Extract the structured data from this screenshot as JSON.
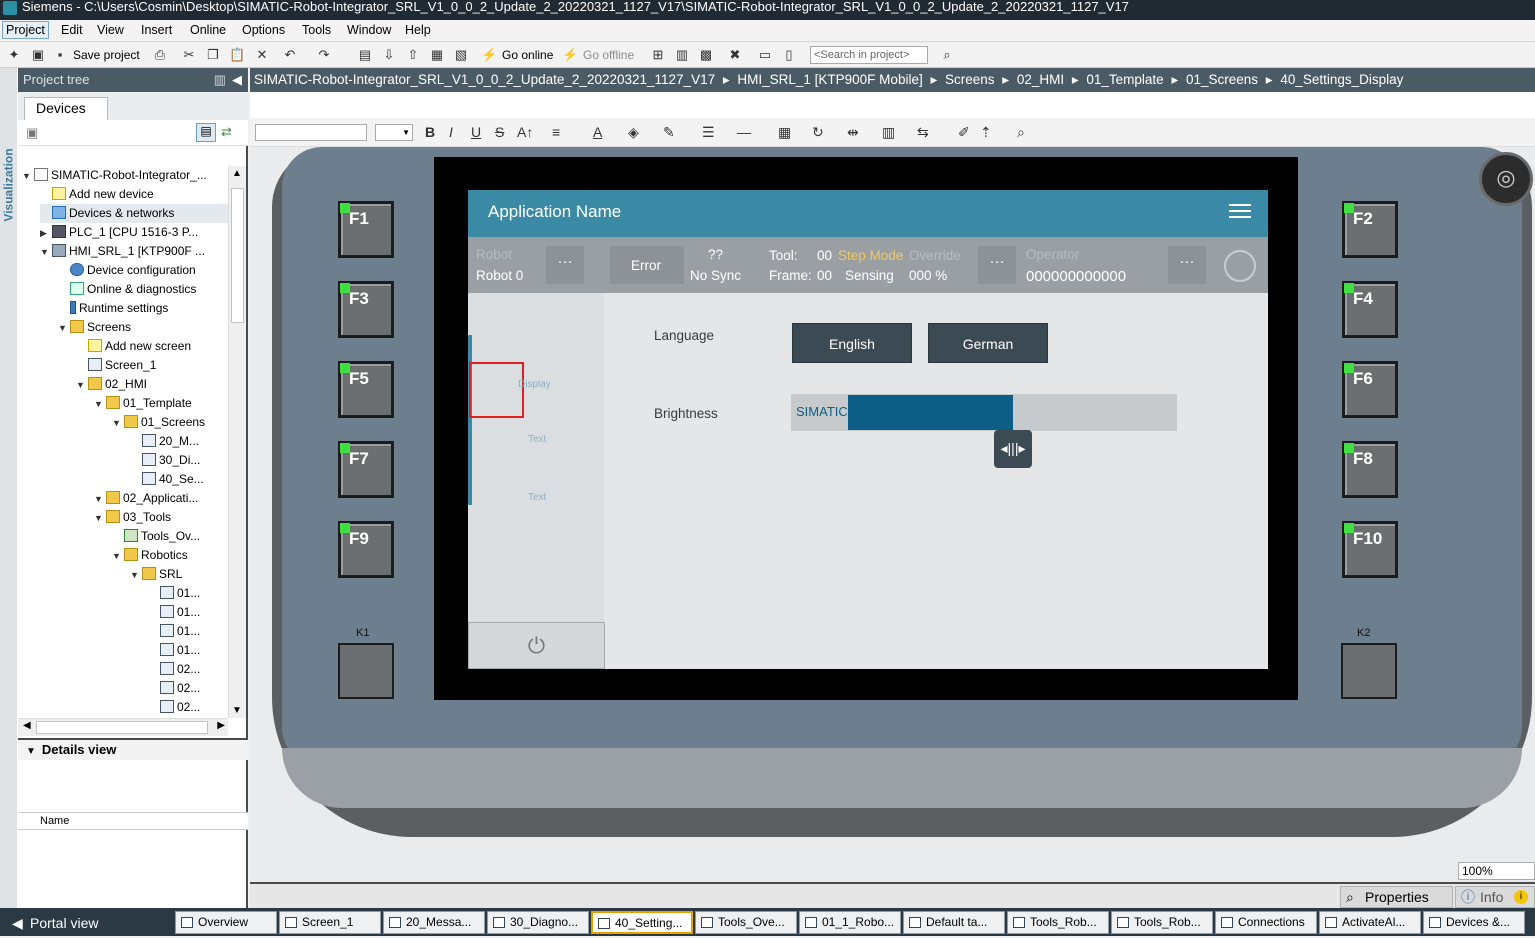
{
  "window": {
    "title": "Siemens  -  C:\\Users\\Cosmin\\Desktop\\SIMATIC-Robot-Integrator_SRL_V1_0_0_2_Update_2_20220321_1127_V17\\SIMATIC-Robot-Integrator_SRL_V1_0_0_2_Update_2_20220321_1127_V17"
  },
  "menu": [
    "Project",
    "Edit",
    "View",
    "Insert",
    "Online",
    "Options",
    "Tools",
    "Window",
    "Help"
  ],
  "toolbar": {
    "save_label": "Save project",
    "go_online_label": "Go online",
    "go_offline_label": "Go offline",
    "search_placeholder": "<Search in project>"
  },
  "left_panel": {
    "vertical_tab": "Visualization",
    "title": "Project tree",
    "devices_tab": "Devices",
    "tree": [
      {
        "label": "SIMATIC-Robot-Integrator_...",
        "indent": 0,
        "arrow": "▼",
        "icon": "proj"
      },
      {
        "label": "Add new device",
        "indent": 1,
        "arrow": "",
        "icon": "add"
      },
      {
        "label": "Devices & networks",
        "indent": 1,
        "arrow": "",
        "icon": "net",
        "selected": true
      },
      {
        "label": "PLC_1 [CPU 1516-3 P...",
        "indent": 1,
        "arrow": "▶",
        "icon": "plc"
      },
      {
        "label": "HMI_SRL_1 [KTP900F ...",
        "indent": 1,
        "arrow": "▼",
        "icon": "hmi"
      },
      {
        "label": "Device configuration",
        "indent": 2,
        "arrow": "",
        "icon": "gear"
      },
      {
        "label": "Online & diagnostics",
        "indent": 2,
        "arrow": "",
        "icon": "diag"
      },
      {
        "label": "Runtime settings",
        "indent": 2,
        "arrow": "",
        "icon": "run"
      },
      {
        "label": "Screens",
        "indent": 2,
        "arrow": "▼",
        "icon": "folder"
      },
      {
        "label": "Add new screen",
        "indent": 3,
        "arrow": "",
        "icon": "add"
      },
      {
        "label": "Screen_1",
        "indent": 3,
        "arrow": "",
        "icon": "screen"
      },
      {
        "label": "02_HMI",
        "indent": 3,
        "arrow": "▼",
        "icon": "folder"
      },
      {
        "label": "01_Template",
        "indent": 4,
        "arrow": "▼",
        "icon": "folder"
      },
      {
        "label": "01_Screens",
        "indent": 5,
        "arrow": "▼",
        "icon": "folder"
      },
      {
        "label": "20_M...",
        "indent": 6,
        "arrow": "",
        "icon": "screen"
      },
      {
        "label": "30_Di...",
        "indent": 6,
        "arrow": "",
        "icon": "screen"
      },
      {
        "label": "40_Se...",
        "indent": 6,
        "arrow": "",
        "icon": "screen"
      },
      {
        "label": "02_Applicati...",
        "indent": 4,
        "arrow": "▼",
        "icon": "folder"
      },
      {
        "label": "03_Tools",
        "indent": 4,
        "arrow": "▼",
        "icon": "folder"
      },
      {
        "label": "Tools_Ov...",
        "indent": 5,
        "arrow": "",
        "icon": "tool"
      },
      {
        "label": "Robotics",
        "indent": 5,
        "arrow": "▼",
        "icon": "folder"
      },
      {
        "label": "SRL",
        "indent": 6,
        "arrow": "▼",
        "icon": "folder"
      },
      {
        "label": "01...",
        "indent": 7,
        "arrow": "",
        "icon": "screen"
      },
      {
        "label": "01...",
        "indent": 7,
        "arrow": "",
        "icon": "screen"
      },
      {
        "label": "01...",
        "indent": 7,
        "arrow": "",
        "icon": "screen"
      },
      {
        "label": "01...",
        "indent": 7,
        "arrow": "",
        "icon": "screen"
      },
      {
        "label": "02...",
        "indent": 7,
        "arrow": "",
        "icon": "screen"
      },
      {
        "label": "02...",
        "indent": 7,
        "arrow": "",
        "icon": "screen"
      },
      {
        "label": "02...",
        "indent": 7,
        "arrow": "",
        "icon": "screen"
      }
    ],
    "details_title": "Details view",
    "details_column": "Name"
  },
  "breadcrumb": [
    "SIMATIC-Robot-Integrator_SRL_V1_0_0_2_Update_2_20220321_1127_V17",
    "HMI_SRL_1 [KTP900F Mobile]",
    "Screens",
    "02_HMI",
    "01_Template",
    "01_Screens",
    "40_Settings_Display"
  ],
  "hmi": {
    "app_name": "Application Name",
    "robot_label": "Robot",
    "robot_value": "Robot 0",
    "error_label": "Error",
    "sync_value": "??",
    "sync_label": "No Sync",
    "tool_label": "Tool:",
    "tool_value": "00",
    "step_mode": "Step Mode",
    "override_label": "Override",
    "frame_label": "Frame:",
    "frame_value": "00",
    "sensing": "Sensing",
    "override_value": "000 %",
    "operator_label": "Operator",
    "operator_value": "000000000000",
    "nav_display": "Display",
    "nav_text1": "Text",
    "nav_text2": "Text",
    "language_label": "Language",
    "english_btn": "English",
    "german_btn": "German",
    "brightness_label": "Brightness",
    "slider_text": "SIMATIC",
    "brightness_level_percent": 43,
    "fkeys": [
      "F1",
      "F2",
      "F3",
      "F4",
      "F5",
      "F6",
      "F7",
      "F8",
      "F9",
      "F10"
    ],
    "k1": "K1",
    "k2": "K2"
  },
  "zoom": "100%",
  "bottom_tabs": {
    "properties": "Properties",
    "info": "Info"
  },
  "taskbar": {
    "portal": "Portal view",
    "tasks": [
      "Overview",
      "Screen_1",
      "20_Messa...",
      "30_Diagno...",
      "40_Setting...",
      "Tools_Ove...",
      "01_1_Robo...",
      "Default ta...",
      "Tools_Rob...",
      "Tools_Rob...",
      "Connections",
      "ActivateAl...",
      "Devices &..."
    ],
    "active_index": 4
  },
  "colors": {
    "hmi_accent": "#3b8aa5",
    "slider_fill": "#0c5e86",
    "fkey_led": "#3fe03f",
    "step_mode": "#f3c85f"
  }
}
